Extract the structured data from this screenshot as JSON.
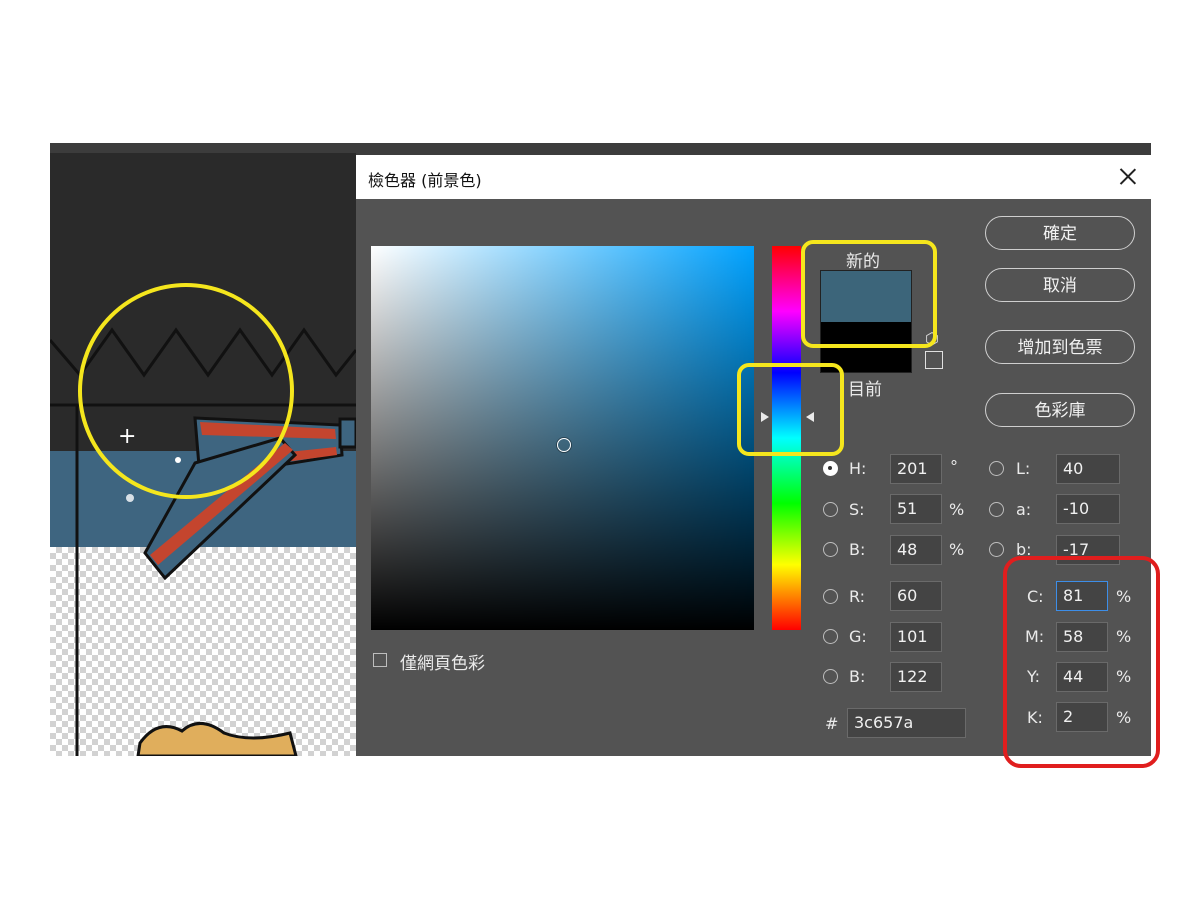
{
  "dialog": {
    "title": "檢色器 (前景色)"
  },
  "swatches": {
    "new_label": "新的",
    "current_label": "目前",
    "new_color": "#3c657a",
    "current_color": "#000000"
  },
  "buttons": {
    "ok": "確定",
    "cancel": "取消",
    "add_to_swatches": "增加到色票",
    "color_libraries": "色彩庫"
  },
  "hsb": {
    "h_label": "H:",
    "h_value": "201",
    "h_unit": "°",
    "s_label": "S:",
    "s_value": "51",
    "s_unit": "%",
    "b_label": "B:",
    "b_value": "48",
    "b_unit": "%"
  },
  "lab": {
    "l_label": "L:",
    "l_value": "40",
    "a_label": "a:",
    "a_value": "-10",
    "b_label": "b:",
    "b_value": "-17"
  },
  "rgb": {
    "r_label": "R:",
    "r_value": "60",
    "g_label": "G:",
    "g_value": "101",
    "b_label": "B:",
    "b_value": "122"
  },
  "cmyk": {
    "c_label": "C:",
    "c_value": "81",
    "c_unit": "%",
    "m_label": "M:",
    "m_value": "58",
    "m_unit": "%",
    "y_label": "Y:",
    "y_value": "44",
    "y_unit": "%",
    "k_label": "K:",
    "k_value": "2",
    "k_unit": "%"
  },
  "hex": {
    "label": "#",
    "value": "3c657a"
  },
  "web_only": {
    "label": "僅網頁色彩",
    "checked": false
  },
  "selected_mode": "H",
  "colors": {
    "dialog_bg": "#535353",
    "annotation_yellow": "#f5e61d",
    "annotation_red": "#e01e1e",
    "artwork_band": "#3e6580",
    "ribbon_red": "#c4452e"
  }
}
